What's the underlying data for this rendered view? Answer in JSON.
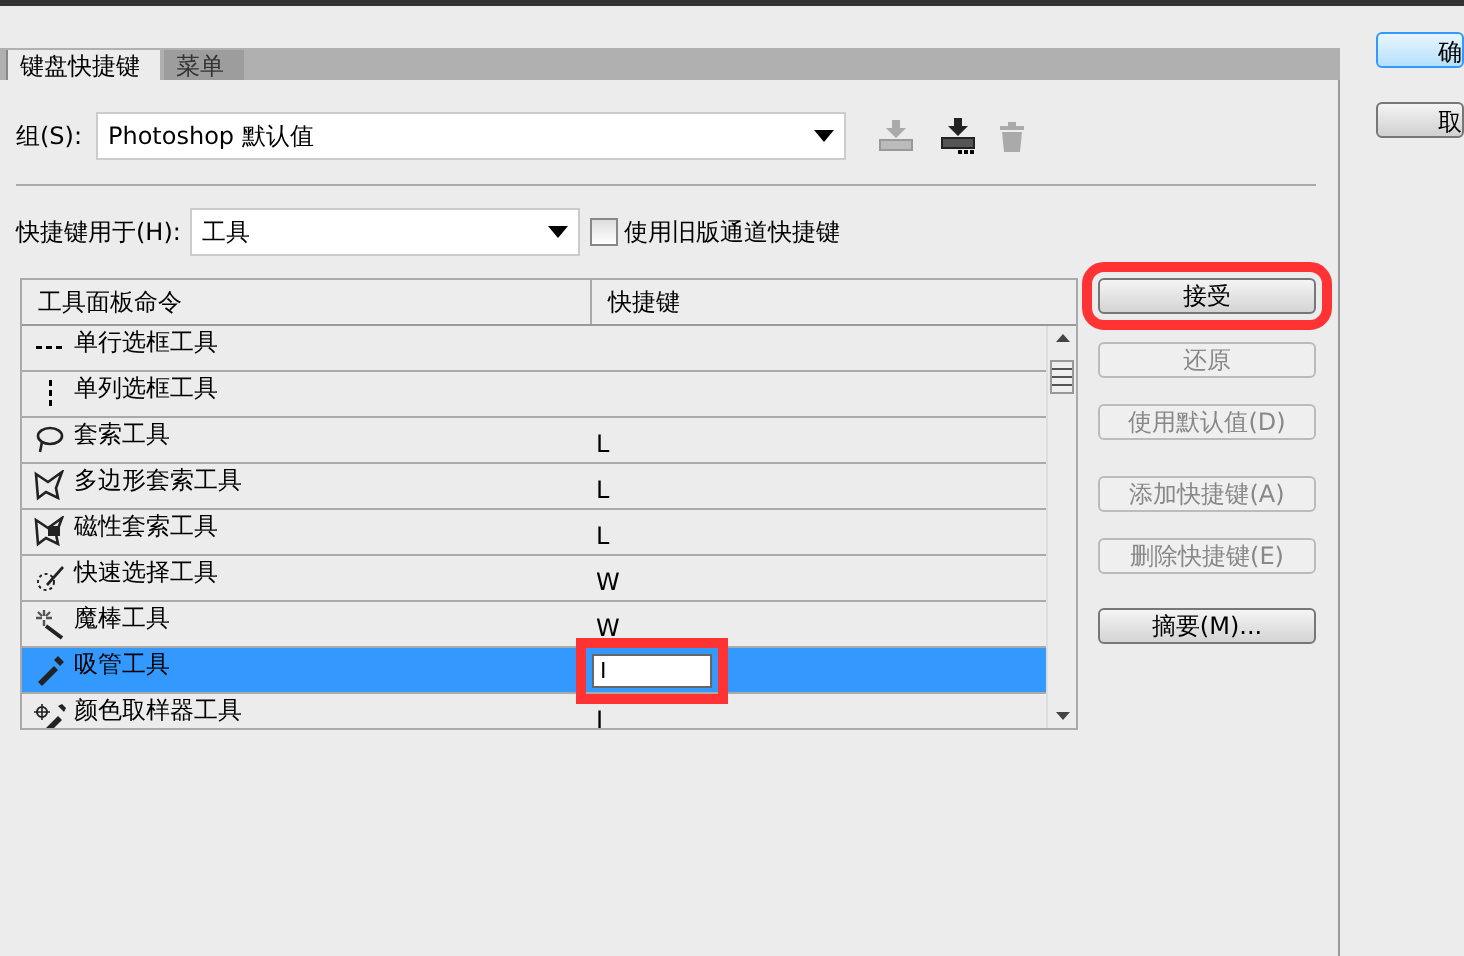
{
  "tabs": [
    {
      "label": "键盘快捷键",
      "selected": true
    },
    {
      "label": "菜单",
      "selected": false
    }
  ],
  "group": {
    "label": "组(S):",
    "value": "Photoshop 默认值"
  },
  "shortcuts_for": {
    "label": "快捷键用于(H):",
    "value": "工具"
  },
  "legacy_checkbox": {
    "label": "使用旧版通道快捷键",
    "checked": false
  },
  "table": {
    "columns": [
      "工具面板命令",
      "快捷键"
    ],
    "rows": [
      {
        "command": "单行选框工具",
        "shortcut": "",
        "selected": false
      },
      {
        "command": "单列选框工具",
        "shortcut": "",
        "selected": false
      },
      {
        "command": "套索工具",
        "shortcut": "L",
        "selected": false
      },
      {
        "command": "多边形套索工具",
        "shortcut": "L",
        "selected": false
      },
      {
        "command": "磁性套索工具",
        "shortcut": "L",
        "selected": false
      },
      {
        "command": "快速选择工具",
        "shortcut": "W",
        "selected": false
      },
      {
        "command": "魔棒工具",
        "shortcut": "W",
        "selected": false
      },
      {
        "command": "吸管工具",
        "shortcut": "I",
        "selected": true,
        "highlighted": true
      },
      {
        "command": "颜色取样器工具",
        "shortcut": "I",
        "selected": false
      }
    ]
  },
  "side_buttons": [
    {
      "label": "接受",
      "disabled": false,
      "highlighted": true
    },
    {
      "label": "还原",
      "disabled": true,
      "highlighted": false
    },
    {
      "label": "使用默认值(D)",
      "disabled": true,
      "highlighted": false
    },
    {
      "label": "添加快捷键(A)",
      "disabled": true,
      "highlighted": false
    },
    {
      "label": "删除快捷键(E)",
      "disabled": true,
      "highlighted": false
    },
    {
      "label": "摘要(M)...",
      "disabled": false,
      "highlighted": false
    }
  ],
  "dialog_buttons": [
    {
      "label": "确",
      "primary": true
    },
    {
      "label": "取",
      "primary": false
    }
  ]
}
